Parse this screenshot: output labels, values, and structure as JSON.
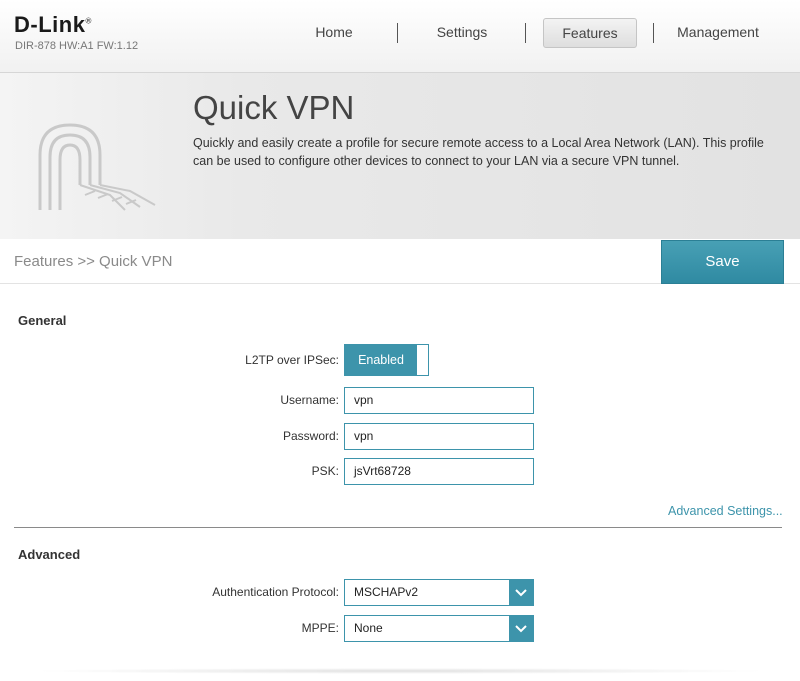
{
  "brand": {
    "logo": "D-Link",
    "trademark": "®",
    "model": "DIR-878 HW:A1 FW:1.12"
  },
  "nav": {
    "items": [
      {
        "label": "Home"
      },
      {
        "label": "Settings"
      },
      {
        "label": "Features",
        "active": true
      },
      {
        "label": "Management"
      }
    ]
  },
  "banner": {
    "title": "Quick VPN",
    "description": "Quickly and easily create a profile for secure remote access to a Local Area Network (LAN). This profile can be used to configure other devices to connect to your LAN via a secure VPN tunnel.",
    "icon": "vpn-tunnel-icon"
  },
  "breadcrumb": "Features >> Quick VPN",
  "save_label": "Save",
  "general": {
    "title": "General",
    "l2tp": {
      "label": "L2TP over IPSec:",
      "value": "Enabled"
    },
    "username": {
      "label": "Username:",
      "value": "vpn"
    },
    "password": {
      "label": "Password:",
      "value": "vpn"
    },
    "psk": {
      "label": "PSK:",
      "value": "jsVrt68728"
    },
    "advanced_link": "Advanced Settings..."
  },
  "advanced": {
    "title": "Advanced",
    "auth_protocol": {
      "label": "Authentication Protocol:",
      "value": "MSCHAPv2"
    },
    "mppe": {
      "label": "MPPE:",
      "value": "None"
    }
  },
  "colors": {
    "accent": "#3d94ab",
    "save_button": "#3a93aa"
  }
}
